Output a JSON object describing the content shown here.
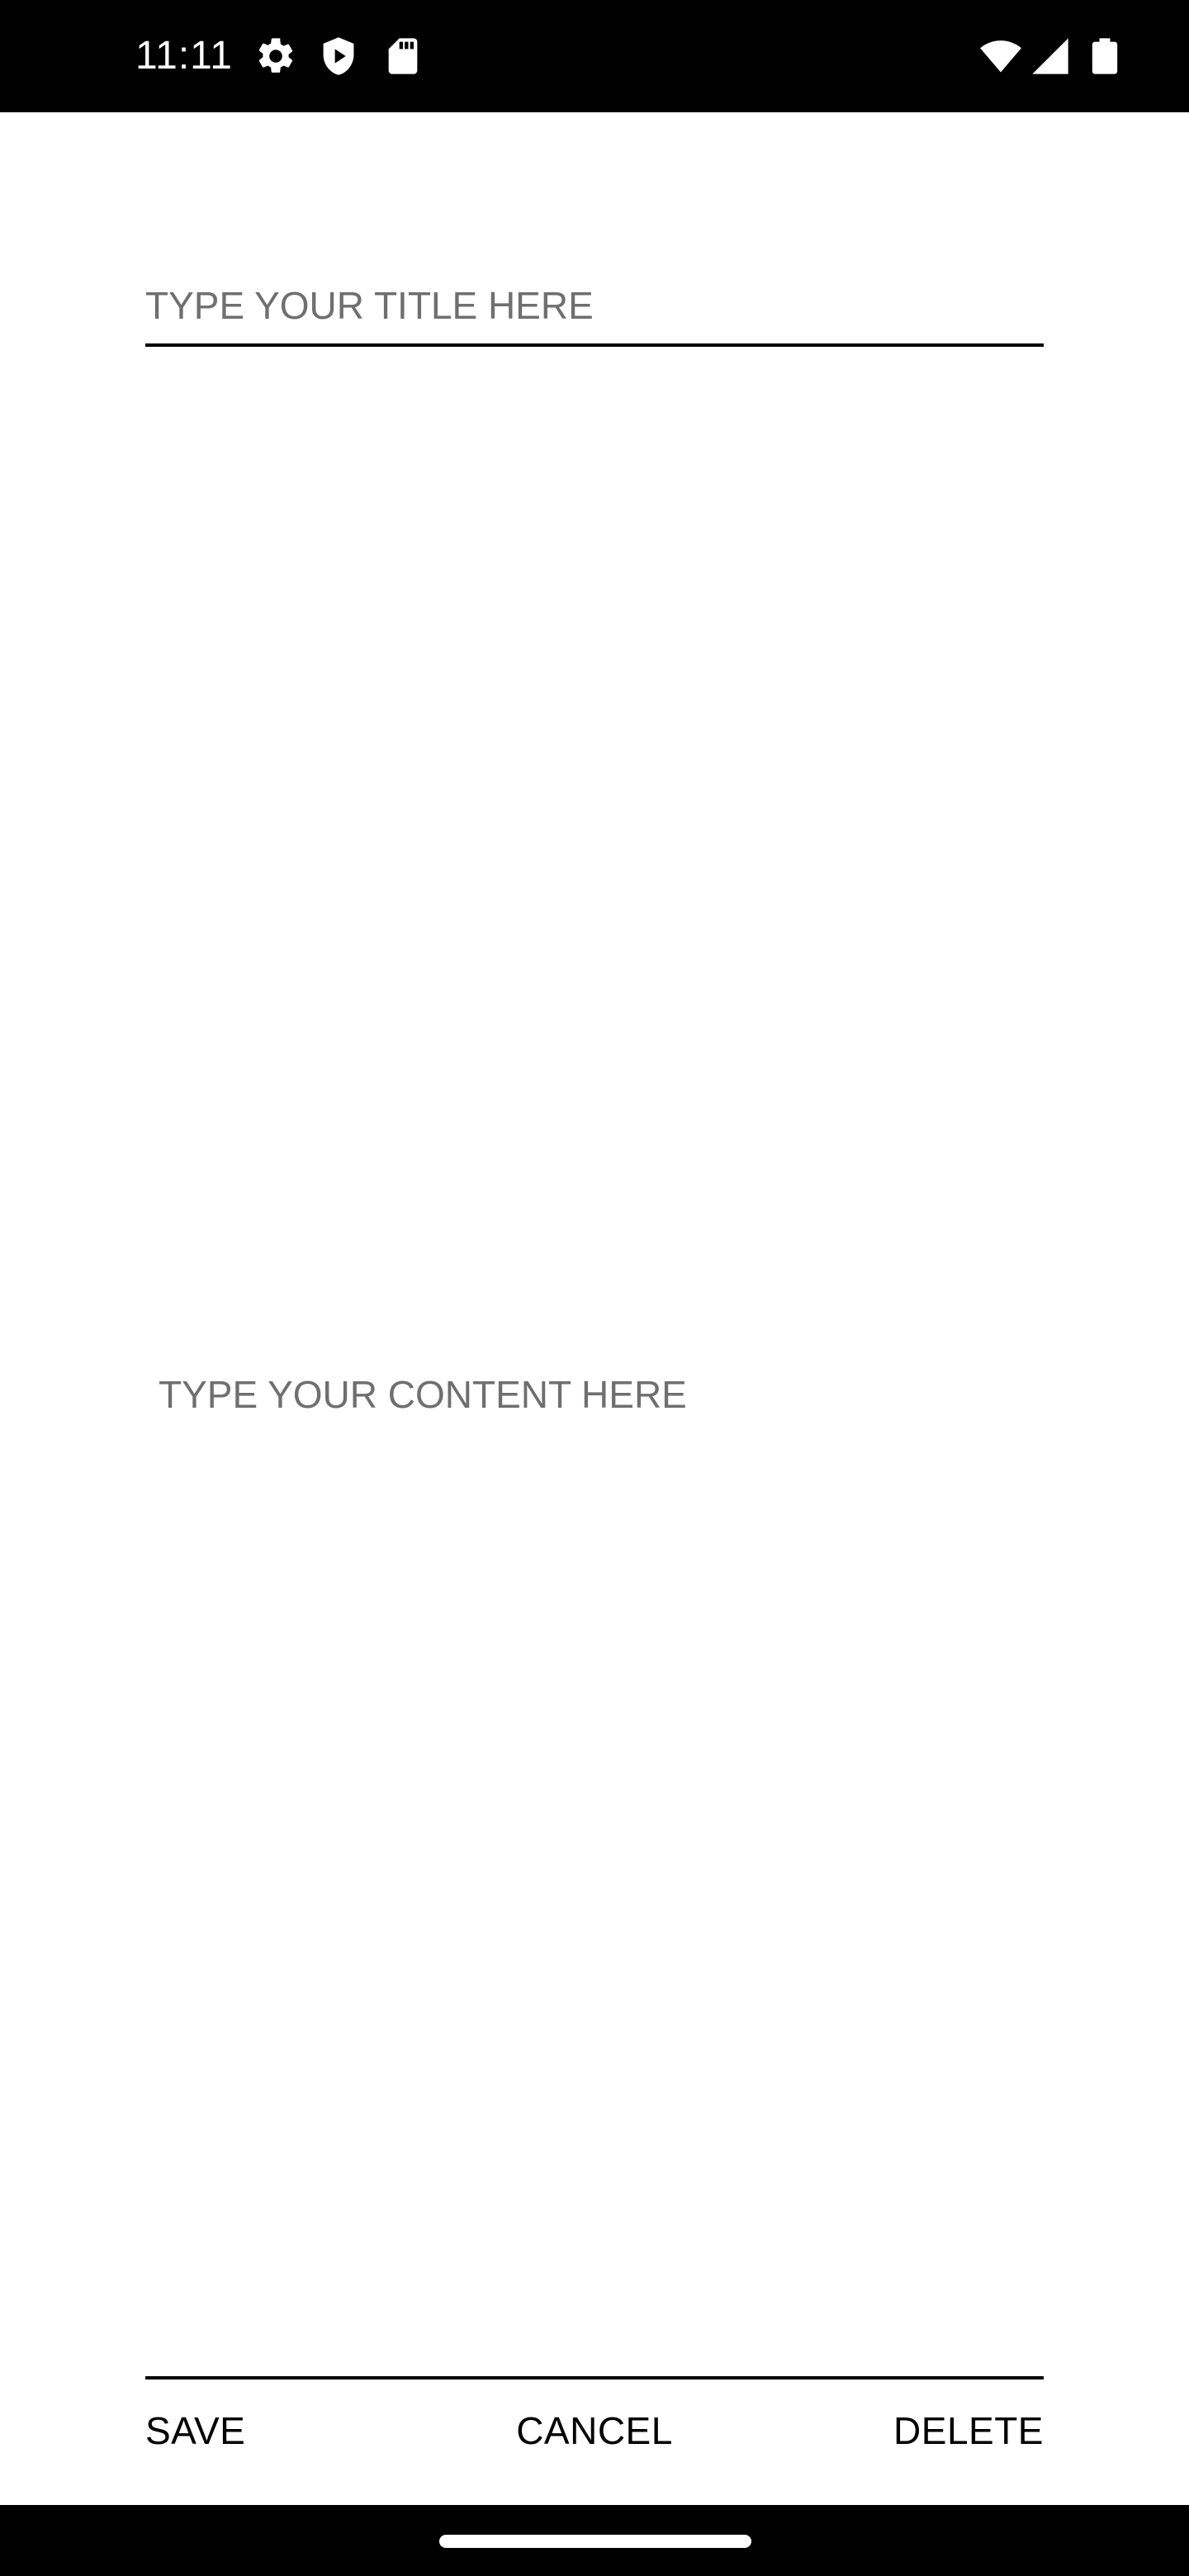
{
  "status_bar": {
    "time": "11:11",
    "icons": [
      "gear-icon",
      "shield-play-icon",
      "sd-card-icon",
      "wifi-icon",
      "signal-icon",
      "battery-icon"
    ]
  },
  "editor": {
    "title_placeholder": "TYPE YOUR TITLE HERE",
    "title_value": "",
    "content_placeholder": "TYPE YOUR CONTENT HERE",
    "content_value": ""
  },
  "actions": {
    "save_label": "SAVE",
    "cancel_label": "CANCEL",
    "delete_label": "DELETE"
  },
  "colors": {
    "background": "#ffffff",
    "status_bar": "#000000",
    "text": "#000000",
    "placeholder": "#6f6f6f"
  }
}
